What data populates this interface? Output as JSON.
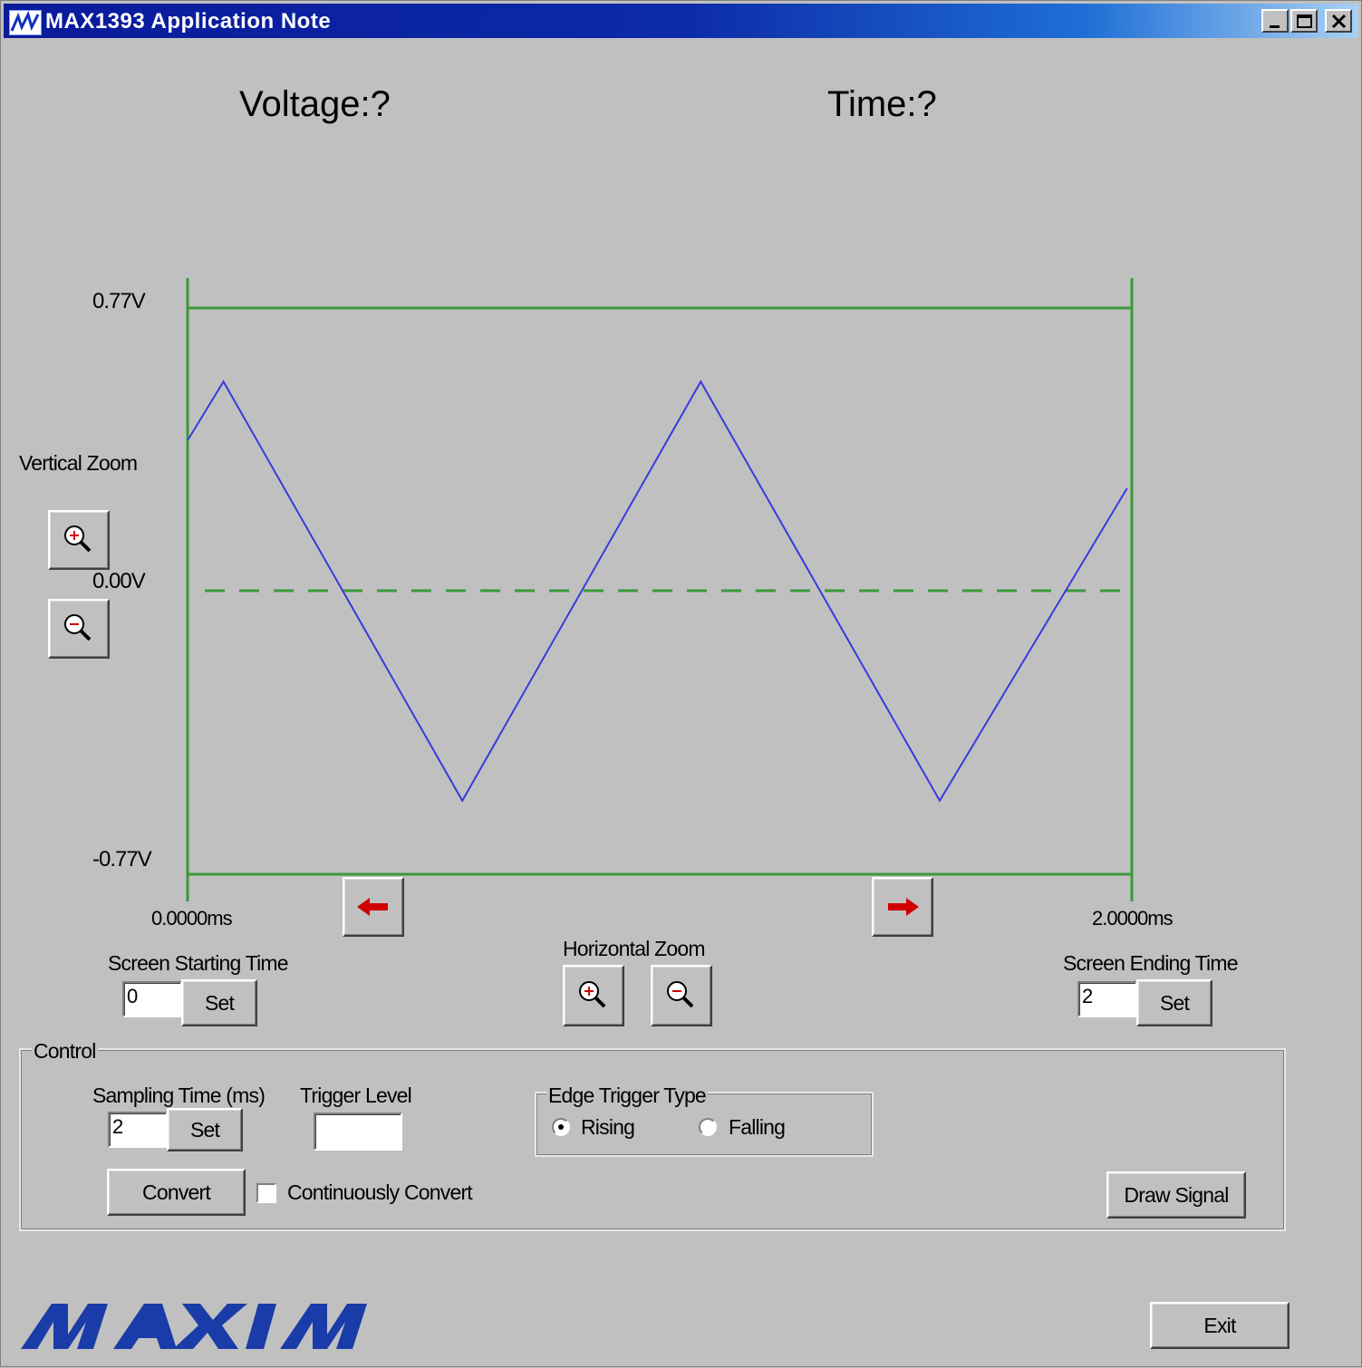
{
  "window": {
    "title": "MAX1393 Application Note",
    "controls": [
      "minimize-icon",
      "maximize-icon",
      "close-icon"
    ]
  },
  "readouts": {
    "voltage": "Voltage:?",
    "time": "Time:?"
  },
  "plot": {
    "y_top_label": "0.77V",
    "y_mid_label": "0.00V",
    "y_bottom_label": "-0.77V",
    "x_start_label": "0.0000ms",
    "x_end_label": "2.0000ms",
    "frame_color": "#3a9a3a",
    "signal_color": "#3a3ae0"
  },
  "chart_data": {
    "type": "line",
    "xlim": [
      0,
      2
    ],
    "ylim": [
      -0.77,
      0.77
    ],
    "grid": false,
    "series": [
      {
        "x": [
          0,
          0.076,
          0.582,
          1.087,
          1.593,
          1.99
        ],
        "y": [
          0.41,
          0.57,
          -0.57,
          0.57,
          -0.57,
          0.28
        ]
      }
    ],
    "reference_lines": [
      0.0
    ]
  },
  "vertical_zoom": {
    "label": "Vertical Zoom",
    "zoom_in_icon": "zoom-in-icon",
    "zoom_out_icon": "zoom-out-icon"
  },
  "navigation": {
    "left_icon": "left-arrow-icon",
    "right_icon": "right-arrow-icon"
  },
  "horizontal_zoom": {
    "label": "Horizontal Zoom"
  },
  "screen_start": {
    "label": "Screen Starting Time",
    "value": "0",
    "button": "Set"
  },
  "screen_end": {
    "label": "Screen Ending Time",
    "value": "2",
    "button": "Set"
  },
  "control": {
    "legend": "Control",
    "sampling_label": "Sampling Time (ms)",
    "sampling_value": "2",
    "sampling_button": "Set",
    "trigger_label": "Trigger Level",
    "trigger_value": "",
    "edge_legend": "Edge Trigger Type",
    "rising_label": "Rising",
    "falling_label": "Falling",
    "rising_selected": true,
    "convert_button": "Convert",
    "continuous_label": "Continuously Convert",
    "continuous_checked": false,
    "draw_button": "Draw Signal"
  },
  "footer": {
    "logo_text": "MAXIM",
    "exit_button": "Exit"
  }
}
